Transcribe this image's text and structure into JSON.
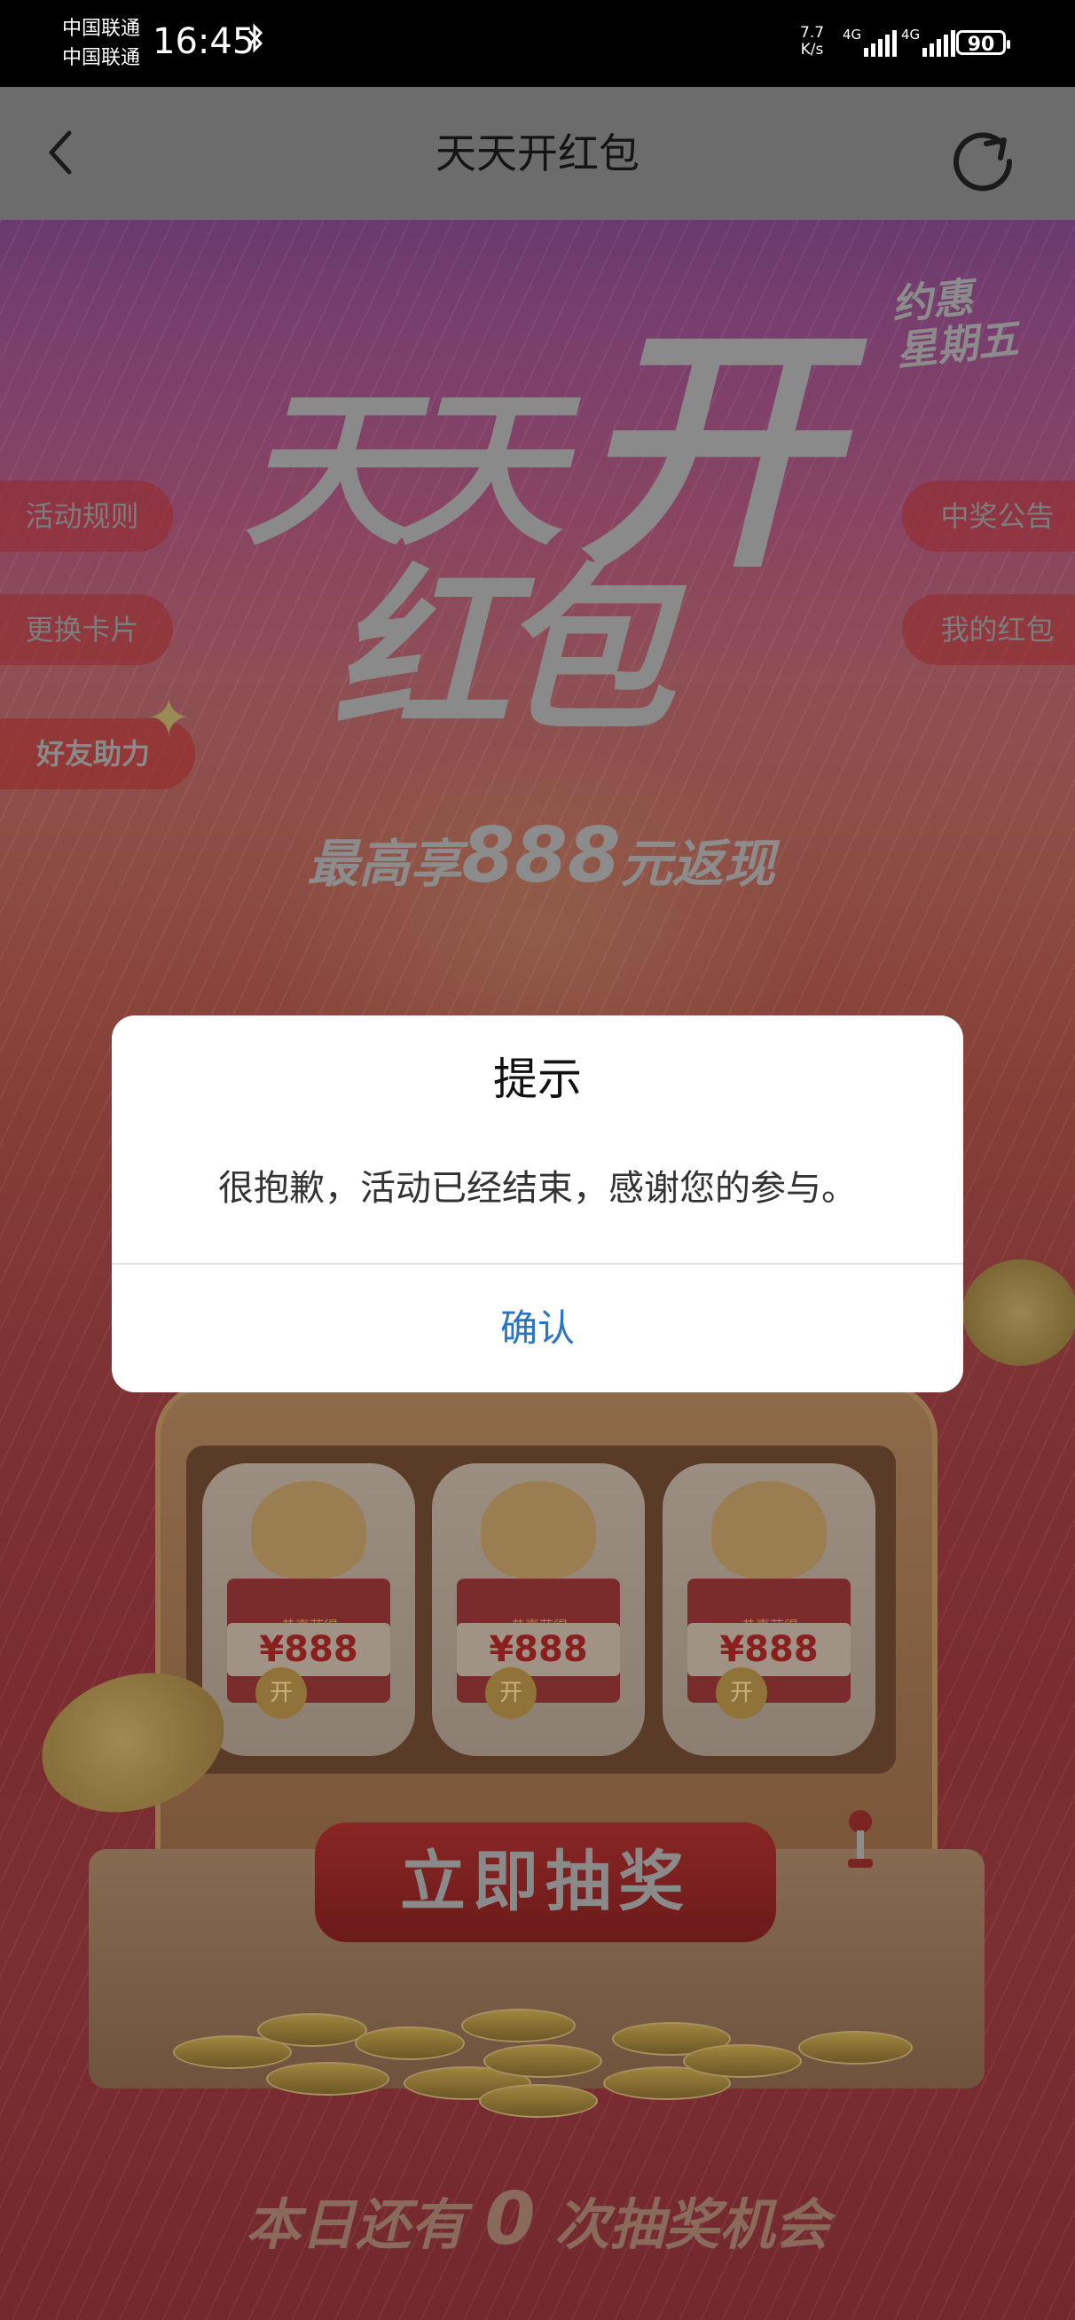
{
  "status_bar": {
    "carrier_1": "中国联通",
    "carrier_2": "中国联通",
    "time": "16:45",
    "net_speed_value": "7.7",
    "net_speed_unit": "K/s",
    "signal_1": "4G",
    "signal_2": "4G",
    "battery": "90"
  },
  "nav": {
    "title": "天天开红包"
  },
  "banner": {
    "title_line1": "天天",
    "title_open": "开",
    "title_line2": "红包",
    "subtitle_prefix": "最高享",
    "subtitle_amount": "888",
    "subtitle_suffix": "元返现",
    "stamp_line1": "约惠",
    "stamp_line2": "星期五"
  },
  "side_menu": {
    "rules": "活动规则",
    "change_card": "更换卡片",
    "friend_help": "好友助力",
    "winners": "中奖公告",
    "my_red_packets": "我的红包"
  },
  "slot_machine": {
    "reels": [
      {
        "label": "恭喜获得",
        "prize": "¥888",
        "coin": "开"
      },
      {
        "label": "恭喜获得",
        "prize": "¥888",
        "coin": "开"
      },
      {
        "label": "恭喜获得",
        "prize": "¥888",
        "coin": "开"
      }
    ],
    "draw_button": "立即抽奖",
    "chances_prefix": "本日还有",
    "chances_count": "0",
    "chances_suffix": "次抽奖机会"
  },
  "dialog": {
    "title": "提示",
    "message": "很抱歉，活动已经结束，感谢您的参与。",
    "confirm": "确认"
  }
}
